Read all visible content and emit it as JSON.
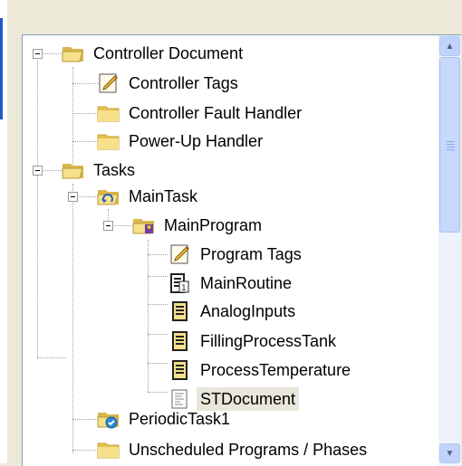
{
  "tree": {
    "items": [
      {
        "label": "Controller Document",
        "icon": "folder-open-icon"
      },
      {
        "label": "Controller Tags",
        "icon": "tags-icon"
      },
      {
        "label": "Controller Fault Handler",
        "icon": "folder-icon"
      },
      {
        "label": "Power-Up Handler",
        "icon": "folder-icon"
      },
      {
        "label": "Tasks",
        "icon": "folder-open-icon"
      },
      {
        "label": "MainTask",
        "icon": "continuous-task-icon"
      },
      {
        "label": "MainProgram",
        "icon": "program-icon"
      },
      {
        "label": "Program Tags",
        "icon": "tags-icon"
      },
      {
        "label": "MainRoutine",
        "icon": "main-routine-icon"
      },
      {
        "label": "AnalogInputs",
        "icon": "ladder-routine-icon"
      },
      {
        "label": "FillingProcessTank",
        "icon": "ladder-routine-icon"
      },
      {
        "label": "ProcessTemperature",
        "icon": "ladder-routine-icon"
      },
      {
        "label": "STDocument",
        "icon": "st-routine-icon",
        "selected": true
      },
      {
        "label": "PeriodicTask1",
        "icon": "periodic-task-icon"
      },
      {
        "label": "Unscheduled Programs / Phases",
        "icon": "folder-icon"
      }
    ]
  },
  "scrollbar": {
    "up_icon": "chevron-up-icon",
    "down_icon": "chevron-down-icon",
    "grip_icon": "grip-icon"
  },
  "colors": {
    "window_bg": "#ece9d8",
    "tree_bg": "#ffffff",
    "selection_bg": "#e9e6dc",
    "scroll_thumb": "#c6d8fb"
  }
}
